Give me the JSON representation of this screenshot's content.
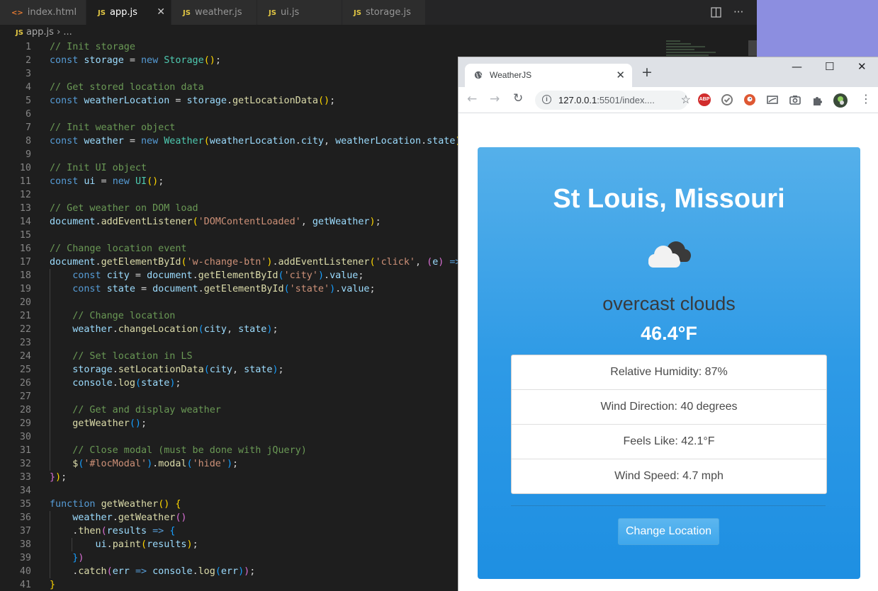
{
  "editor": {
    "tabs": [
      {
        "name": "index.html",
        "type": "html",
        "active": false
      },
      {
        "name": "app.js",
        "type": "js",
        "active": true
      },
      {
        "name": "weather.js",
        "type": "js",
        "active": false
      },
      {
        "name": "ui.js",
        "type": "js",
        "active": false
      },
      {
        "name": "storage.js",
        "type": "js",
        "active": false
      }
    ],
    "tab_icon_js": "JS",
    "tab_icon_html": "<>",
    "close_glyph": "✕",
    "breadcrumb": {
      "icon": "JS",
      "file": "app.js",
      "sep": "›",
      "rest": "..."
    },
    "line_numbers": [
      "1",
      "2",
      "3",
      "4",
      "5",
      "6",
      "7",
      "8",
      "9",
      "10",
      "11",
      "12",
      "13",
      "14",
      "15",
      "16",
      "17",
      "18",
      "19",
      "20",
      "21",
      "22",
      "23",
      "24",
      "25",
      "26",
      "27",
      "28",
      "29",
      "30",
      "31",
      "32",
      "33",
      "34",
      "35",
      "36",
      "37",
      "38",
      "39",
      "40",
      "41"
    ],
    "code": [
      [
        [
          "cm",
          "// Init storage"
        ]
      ],
      [
        [
          "kw",
          "const "
        ],
        [
          "vr",
          "storage"
        ],
        [
          "df",
          " = "
        ],
        [
          "kw",
          "new "
        ],
        [
          "cl",
          "Storage"
        ],
        [
          "p1",
          "()"
        ],
        [
          "df",
          ";"
        ]
      ],
      [],
      [
        [
          "cm",
          "// Get stored location data"
        ]
      ],
      [
        [
          "kw",
          "const "
        ],
        [
          "vr",
          "weatherLocation"
        ],
        [
          "df",
          " = "
        ],
        [
          "vr",
          "storage"
        ],
        [
          "df",
          "."
        ],
        [
          "fn",
          "getLocationData"
        ],
        [
          "p1",
          "()"
        ],
        [
          "df",
          ";"
        ]
      ],
      [],
      [
        [
          "cm",
          "// Init weather object"
        ]
      ],
      [
        [
          "kw",
          "const "
        ],
        [
          "vr",
          "weather"
        ],
        [
          "df",
          " = "
        ],
        [
          "kw",
          "new "
        ],
        [
          "cl",
          "Weather"
        ],
        [
          "p1",
          "("
        ],
        [
          "vr",
          "weatherLocation"
        ],
        [
          "df",
          "."
        ],
        [
          "vr",
          "city"
        ],
        [
          "df",
          ", "
        ],
        [
          "vr",
          "weatherLocation"
        ],
        [
          "df",
          "."
        ],
        [
          "vr",
          "state"
        ],
        [
          "p1",
          ")"
        ],
        [
          "df",
          ";"
        ]
      ],
      [],
      [
        [
          "cm",
          "// Init UI object"
        ]
      ],
      [
        [
          "kw",
          "const "
        ],
        [
          "vr",
          "ui"
        ],
        [
          "df",
          " = "
        ],
        [
          "kw",
          "new "
        ],
        [
          "cl",
          "UI"
        ],
        [
          "p1",
          "()"
        ],
        [
          "df",
          ";"
        ]
      ],
      [],
      [
        [
          "cm",
          "// Get weather on DOM load"
        ]
      ],
      [
        [
          "vr",
          "document"
        ],
        [
          "df",
          "."
        ],
        [
          "fn",
          "addEventListener"
        ],
        [
          "p1",
          "("
        ],
        [
          "st",
          "'DOMContentLoaded'"
        ],
        [
          "df",
          ", "
        ],
        [
          "vr",
          "getWeather"
        ],
        [
          "p1",
          ")"
        ],
        [
          "df",
          ";"
        ]
      ],
      [],
      [
        [
          "cm",
          "// Change location event"
        ]
      ],
      [
        [
          "vr",
          "document"
        ],
        [
          "df",
          "."
        ],
        [
          "fn",
          "getElementById"
        ],
        [
          "p1",
          "("
        ],
        [
          "st",
          "'w-change-btn'"
        ],
        [
          "p1",
          ")"
        ],
        [
          "df",
          "."
        ],
        [
          "fn",
          "addEventListener"
        ],
        [
          "p1",
          "("
        ],
        [
          "st",
          "'click'"
        ],
        [
          "df",
          ", "
        ],
        [
          "p2",
          "("
        ],
        [
          "vr",
          "e"
        ],
        [
          "p2",
          ")"
        ],
        [
          "df",
          " "
        ],
        [
          "kw",
          "=>"
        ],
        [
          "df",
          " "
        ],
        [
          "p2",
          "{"
        ]
      ],
      [
        [
          "df",
          "    "
        ],
        [
          "kw",
          "const "
        ],
        [
          "vr",
          "city"
        ],
        [
          "df",
          " = "
        ],
        [
          "vr",
          "document"
        ],
        [
          "df",
          "."
        ],
        [
          "fn",
          "getElementById"
        ],
        [
          "p3",
          "("
        ],
        [
          "st",
          "'city'"
        ],
        [
          "p3",
          ")"
        ],
        [
          "df",
          "."
        ],
        [
          "vr",
          "value"
        ],
        [
          "df",
          ";"
        ]
      ],
      [
        [
          "df",
          "    "
        ],
        [
          "kw",
          "const "
        ],
        [
          "vr",
          "state"
        ],
        [
          "df",
          " = "
        ],
        [
          "vr",
          "document"
        ],
        [
          "df",
          "."
        ],
        [
          "fn",
          "getElementById"
        ],
        [
          "p3",
          "("
        ],
        [
          "st",
          "'state'"
        ],
        [
          "p3",
          ")"
        ],
        [
          "df",
          "."
        ],
        [
          "vr",
          "value"
        ],
        [
          "df",
          ";"
        ]
      ],
      [],
      [
        [
          "df",
          "    "
        ],
        [
          "cm",
          "// Change location"
        ]
      ],
      [
        [
          "df",
          "    "
        ],
        [
          "vr",
          "weather"
        ],
        [
          "df",
          "."
        ],
        [
          "fn",
          "changeLocation"
        ],
        [
          "p3",
          "("
        ],
        [
          "vr",
          "city"
        ],
        [
          "df",
          ", "
        ],
        [
          "vr",
          "state"
        ],
        [
          "p3",
          ")"
        ],
        [
          "df",
          ";"
        ]
      ],
      [],
      [
        [
          "df",
          "    "
        ],
        [
          "cm",
          "// Set location in LS"
        ]
      ],
      [
        [
          "df",
          "    "
        ],
        [
          "vr",
          "storage"
        ],
        [
          "df",
          "."
        ],
        [
          "fn",
          "setLocationData"
        ],
        [
          "p3",
          "("
        ],
        [
          "vr",
          "city"
        ],
        [
          "df",
          ", "
        ],
        [
          "vr",
          "state"
        ],
        [
          "p3",
          ")"
        ],
        [
          "df",
          ";"
        ]
      ],
      [
        [
          "df",
          "    "
        ],
        [
          "vr",
          "console"
        ],
        [
          "df",
          "."
        ],
        [
          "fn",
          "log"
        ],
        [
          "p3",
          "("
        ],
        [
          "vr",
          "state"
        ],
        [
          "p3",
          ")"
        ],
        [
          "df",
          ";"
        ]
      ],
      [],
      [
        [
          "df",
          "    "
        ],
        [
          "cm",
          "// Get and display weather"
        ]
      ],
      [
        [
          "df",
          "    "
        ],
        [
          "fn",
          "getWeather"
        ],
        [
          "p3",
          "()"
        ],
        [
          "df",
          ";"
        ]
      ],
      [],
      [
        [
          "df",
          "    "
        ],
        [
          "cm",
          "// Close modal (must be done with jQuery)"
        ]
      ],
      [
        [
          "df",
          "    "
        ],
        [
          "fn",
          "$"
        ],
        [
          "p3",
          "("
        ],
        [
          "st",
          "'#locModal'"
        ],
        [
          "p3",
          ")"
        ],
        [
          "df",
          "."
        ],
        [
          "fn",
          "modal"
        ],
        [
          "p3",
          "("
        ],
        [
          "st",
          "'hide'"
        ],
        [
          "p3",
          ")"
        ],
        [
          "df",
          ";"
        ]
      ],
      [
        [
          "p2",
          "}"
        ],
        [
          "p1",
          ")"
        ],
        [
          "df",
          ";"
        ]
      ],
      [],
      [
        [
          "kw",
          "function "
        ],
        [
          "fn",
          "getWeather"
        ],
        [
          "p1",
          "()"
        ],
        [
          "df",
          " "
        ],
        [
          "p1",
          "{"
        ]
      ],
      [
        [
          "df",
          "    "
        ],
        [
          "vr",
          "weather"
        ],
        [
          "df",
          "."
        ],
        [
          "fn",
          "getWeather"
        ],
        [
          "p2",
          "()"
        ]
      ],
      [
        [
          "df",
          "    ."
        ],
        [
          "fn",
          "then"
        ],
        [
          "p2",
          "("
        ],
        [
          "vr",
          "results"
        ],
        [
          "df",
          " "
        ],
        [
          "kw",
          "=>"
        ],
        [
          "df",
          " "
        ],
        [
          "p3",
          "{"
        ]
      ],
      [
        [
          "df",
          "        "
        ],
        [
          "vr",
          "ui"
        ],
        [
          "df",
          "."
        ],
        [
          "fn",
          "paint"
        ],
        [
          "p1",
          "("
        ],
        [
          "vr",
          "results"
        ],
        [
          "p1",
          ")"
        ],
        [
          "df",
          ";"
        ]
      ],
      [
        [
          "df",
          "    "
        ],
        [
          "p3",
          "}"
        ],
        [
          "p2",
          ")"
        ]
      ],
      [
        [
          "df",
          "    ."
        ],
        [
          "fn",
          "catch"
        ],
        [
          "p2",
          "("
        ],
        [
          "vr",
          "err"
        ],
        [
          "df",
          " "
        ],
        [
          "kw",
          "=>"
        ],
        [
          "df",
          " "
        ],
        [
          "vr",
          "console"
        ],
        [
          "df",
          "."
        ],
        [
          "fn",
          "log"
        ],
        [
          "p3",
          "("
        ],
        [
          "vr",
          "err"
        ],
        [
          "p3",
          ")"
        ],
        [
          "p2",
          ")"
        ],
        [
          "df",
          ";"
        ]
      ],
      [
        [
          "p1",
          "}"
        ]
      ]
    ],
    "colors": {
      "background": "#1e1e1e",
      "comment": "#6a9955",
      "keyword": "#569cd6",
      "variable": "#9cdcfe",
      "function": "#dcdcaa",
      "class": "#4ec9b0",
      "string": "#ce9178"
    }
  },
  "browser": {
    "tab_title": "WeatherJS",
    "new_tab": "+",
    "window_controls": {
      "minimize": "—",
      "maximize": "☐",
      "close": "✕"
    },
    "nav": {
      "back": "←",
      "forward": "→",
      "reload": "↻"
    },
    "url_host": "127.0.0.1",
    "url_rest": ":5501/index....",
    "star": "☆",
    "menu": "⋮",
    "extensions": [
      "abp-icon",
      "checkmark-icon",
      "duckduckgo-icon",
      "cast-icon",
      "camera-icon",
      "puzzle-icon",
      "profile-avatar"
    ],
    "abp_label": "ABP"
  },
  "weather": {
    "location": "St Louis, Missouri",
    "description": "overcast clouds",
    "temperature": "46.4°F",
    "details": [
      "Relative Humidity: 87%",
      "Wind Direction: 40 degrees",
      "Feels Like: 42.1°F",
      "Wind Speed: 4.7 mph"
    ],
    "button": "Change Location",
    "icon": "overcast-clouds-icon",
    "card_color": "#2e9ae6"
  }
}
